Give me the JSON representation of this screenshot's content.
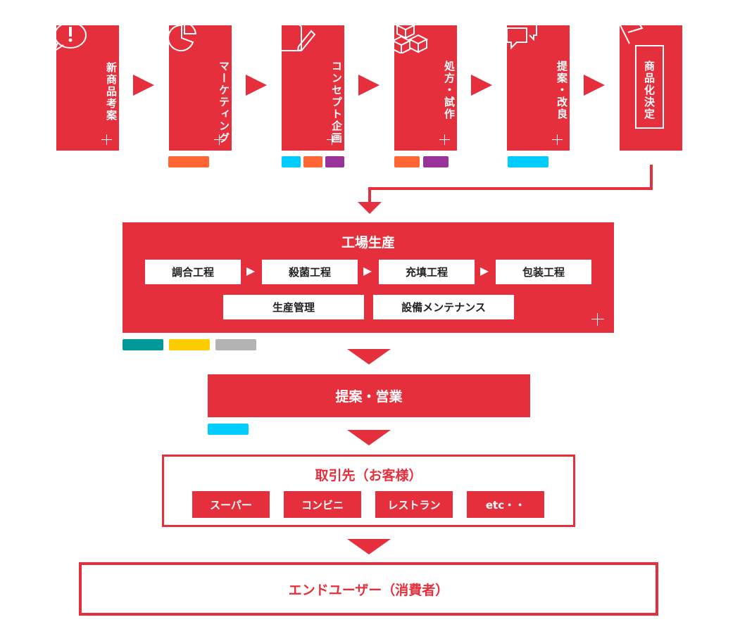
{
  "stages": [
    {
      "label": "新商品考案",
      "icon": "exclamation-bubble-icon"
    },
    {
      "label": "マーケティング",
      "icon": "pie-chart-icon"
    },
    {
      "label": "コンセプト企画",
      "icon": "document-pencil-icon"
    },
    {
      "label": "処方・試作",
      "icon": "boxes-icon"
    },
    {
      "label": "提案・改良",
      "icon": "speech-bubbles-icon"
    },
    {
      "label": "商品化決定",
      "icon": "flag-icon"
    }
  ],
  "factory": {
    "title": "工場生産",
    "steps": [
      "調合工程",
      "殺菌工程",
      "充填工程",
      "包装工程"
    ],
    "support": [
      "生産管理",
      "設備メンテナンス"
    ]
  },
  "sales": {
    "title": "提案・営業"
  },
  "clients": {
    "title": "取引先（お客様）",
    "items": [
      "スーパー",
      "コンビニ",
      "レストラン",
      "etc・・"
    ]
  },
  "end_user": {
    "title": "エンドユーザー（消費者）"
  },
  "colors": {
    "red": "#e62f3c",
    "orange": "#ff6633",
    "cyan": "#00ccff",
    "purple": "#993399",
    "teal": "#009999",
    "yellow": "#ffcc00",
    "gray": "#b3b3b3"
  }
}
